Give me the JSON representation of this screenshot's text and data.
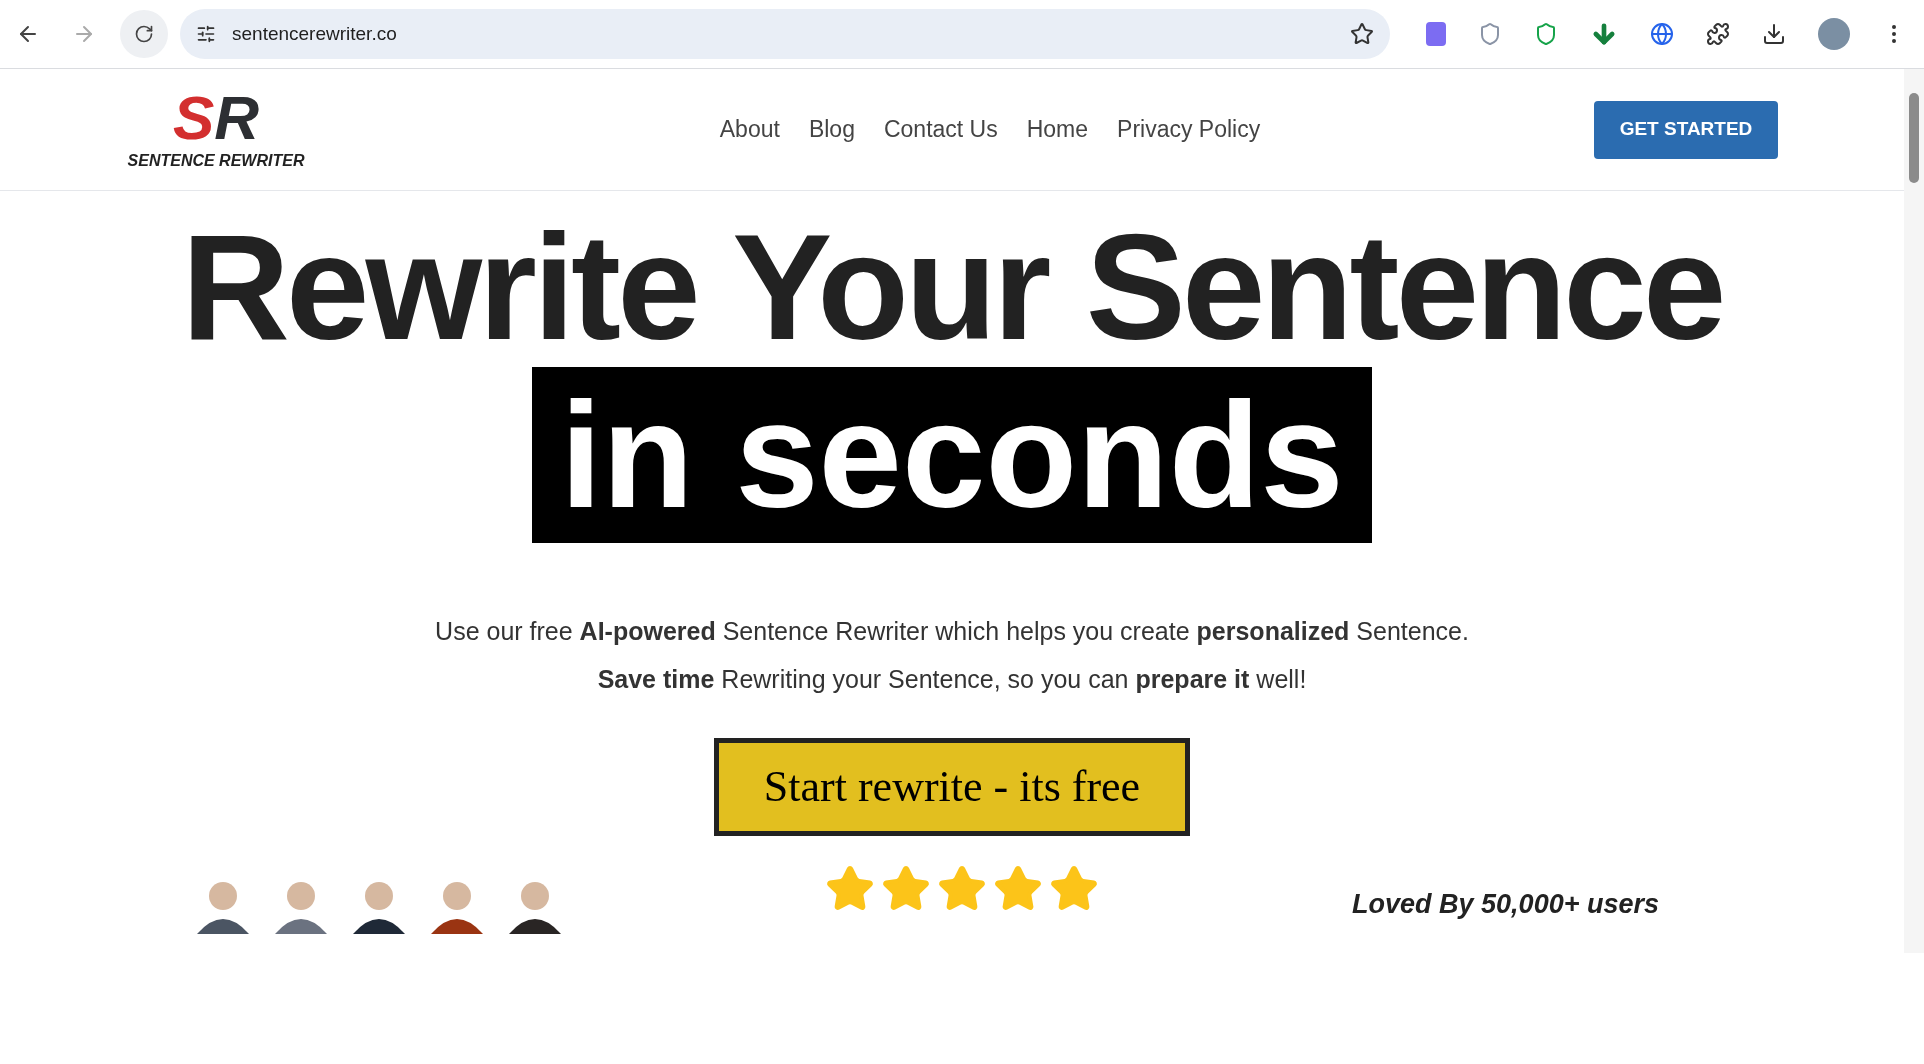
{
  "browser": {
    "url": "sentencerewriter.co"
  },
  "header": {
    "logo_mark": "SR",
    "logo_text": "SENTENCE REWRITER",
    "nav": [
      {
        "label": "About"
      },
      {
        "label": "Blog"
      },
      {
        "label": "Contact Us"
      },
      {
        "label": "Home"
      },
      {
        "label": "Privacy Policy"
      }
    ],
    "cta": "GET STARTED"
  },
  "hero": {
    "headline": "Rewrite Your Sentence",
    "highlight": "in seconds",
    "intro_lines": [
      "Use our free **AI-powered** Sentence Rewriter which helps you create **personalized** Sentence.",
      "**Save time** Rewriting your Sentence, so you can **prepare it** well!"
    ],
    "button": "Start rewrite - its free",
    "stars": 5,
    "loved_by": "Loved By 50,000+ users"
  }
}
